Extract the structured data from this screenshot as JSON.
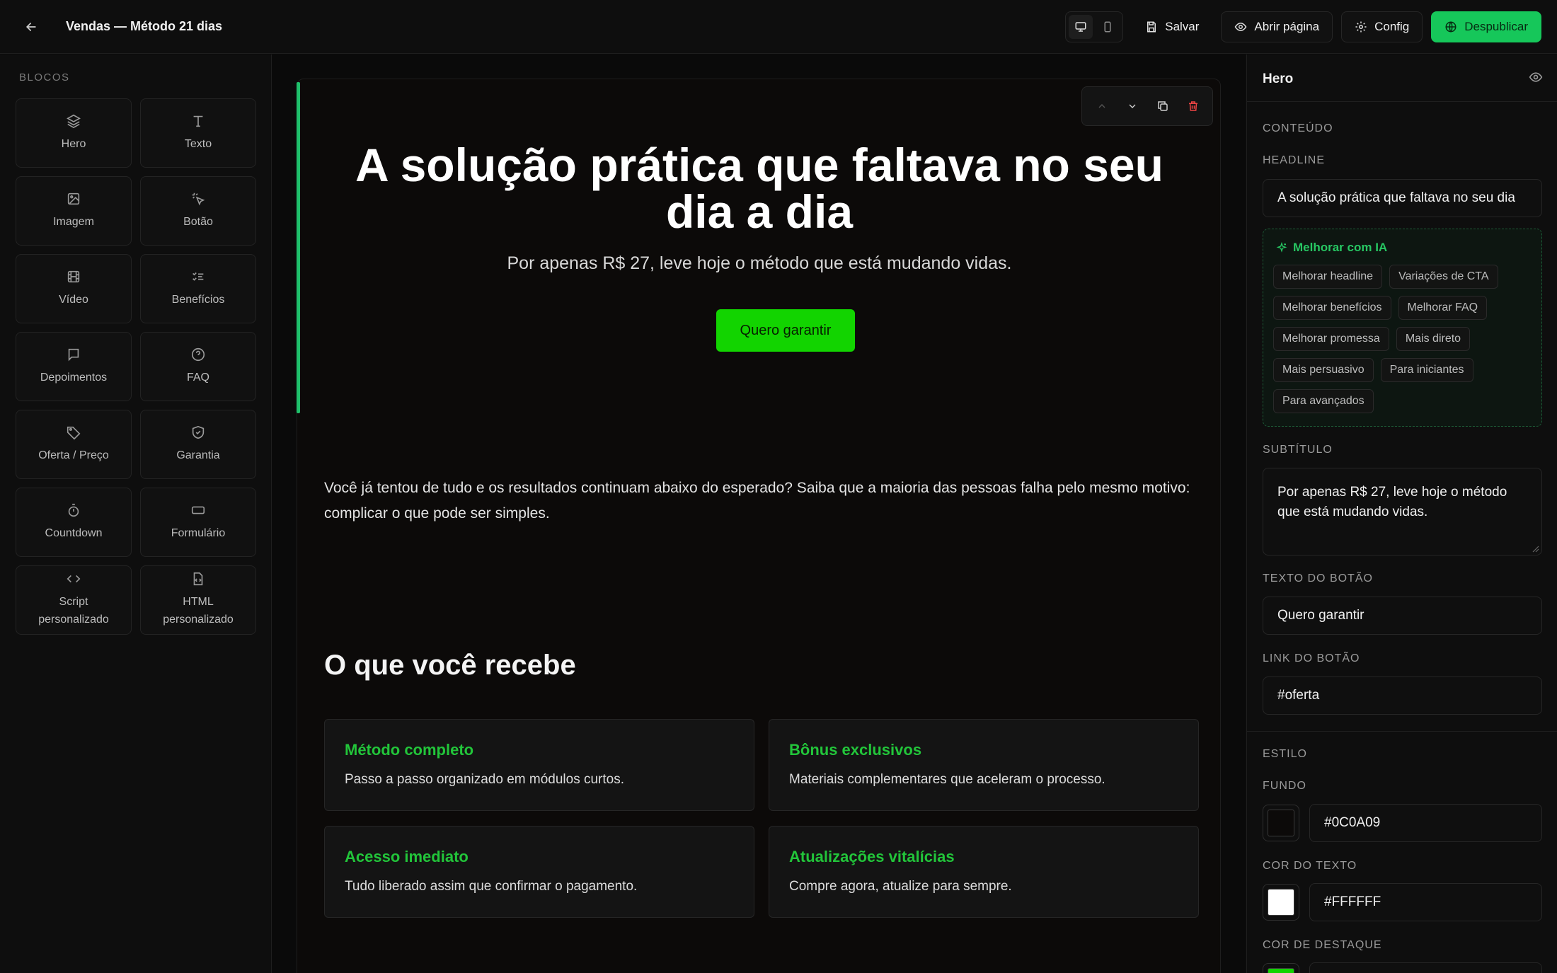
{
  "topbar": {
    "title": "Vendas — Método 21 dias",
    "save_label": "Salvar",
    "open_label": "Abrir página",
    "config_label": "Config",
    "unpublish_label": "Despublicar"
  },
  "sidebar": {
    "title": "BLOCOS",
    "blocks": [
      {
        "label": "Hero",
        "icon": "layers-icon"
      },
      {
        "label": "Texto",
        "icon": "text-icon"
      },
      {
        "label": "Imagem",
        "icon": "image-icon"
      },
      {
        "label": "Botão",
        "icon": "pointer-click-icon"
      },
      {
        "label": "Vídeo",
        "icon": "film-icon"
      },
      {
        "label": "Benefícios",
        "icon": "checklist-icon"
      },
      {
        "label": "Depoimentos",
        "icon": "chat-icon"
      },
      {
        "label": "FAQ",
        "icon": "help-circle-icon"
      },
      {
        "label": "Oferta / Preço",
        "icon": "tag-icon"
      },
      {
        "label": "Garantia",
        "icon": "shield-check-icon"
      },
      {
        "label": "Countdown",
        "icon": "timer-icon"
      },
      {
        "label": "Formulário",
        "icon": "input-form-icon"
      },
      {
        "label": "Script personalizado",
        "icon": "code-icon"
      },
      {
        "label": "HTML personalizado",
        "icon": "file-code-icon"
      }
    ]
  },
  "canvas": {
    "hero": {
      "headline": "A solução prática que faltava no seu dia a dia",
      "subtitle": "Por apenas R$ 27, leve hoje o método que está mudando vidas.",
      "cta": "Quero garantir"
    },
    "text_block": "Você já tentou de tudo e os resultados continuam abaixo do esperado? Saiba que a maioria das pessoas falha pelo mesmo motivo: complicar o que pode ser simples.",
    "benefits": {
      "title": "O que você recebe",
      "items": [
        {
          "title": "Método completo",
          "desc": "Passo a passo organizado em módulos curtos."
        },
        {
          "title": "Bônus exclusivos",
          "desc": "Materiais complementares que aceleram o processo."
        },
        {
          "title": "Acesso imediato",
          "desc": "Tudo liberado assim que confirmar o pagamento."
        },
        {
          "title": "Atualizações vitalícias",
          "desc": "Compre agora, atualize para sempre."
        }
      ]
    }
  },
  "panel": {
    "title": "Hero",
    "content_label": "CONTEÚDO",
    "headline_label": "HEADLINE",
    "headline_value": "A solução prática que faltava no seu dia",
    "ai": {
      "title": "Melhorar com IA",
      "chips": [
        "Melhorar headline",
        "Variações de CTA",
        "Melhorar benefícios",
        "Melhorar FAQ",
        "Melhorar promessa",
        "Mais direto",
        "Mais persuasivo",
        "Para iniciantes",
        "Para avançados"
      ]
    },
    "subtitle_label": "SUBTÍTULO",
    "subtitle_value": "Por apenas R$ 27, leve hoje o método que está mudando vidas.",
    "button_text_label": "TEXTO DO BOTÃO",
    "button_text_value": "Quero garantir",
    "button_link_label": "LINK DO BOTÃO",
    "button_link_value": "#oferta",
    "style_label": "ESTILO",
    "bg_label": "FUNDO",
    "bg_value": "#0C0A09",
    "text_color_label": "COR DO TEXTO",
    "text_color_value": "#FFFFFF",
    "accent_label": "COR DE DESTAQUE",
    "accent_color": "#12D400"
  }
}
